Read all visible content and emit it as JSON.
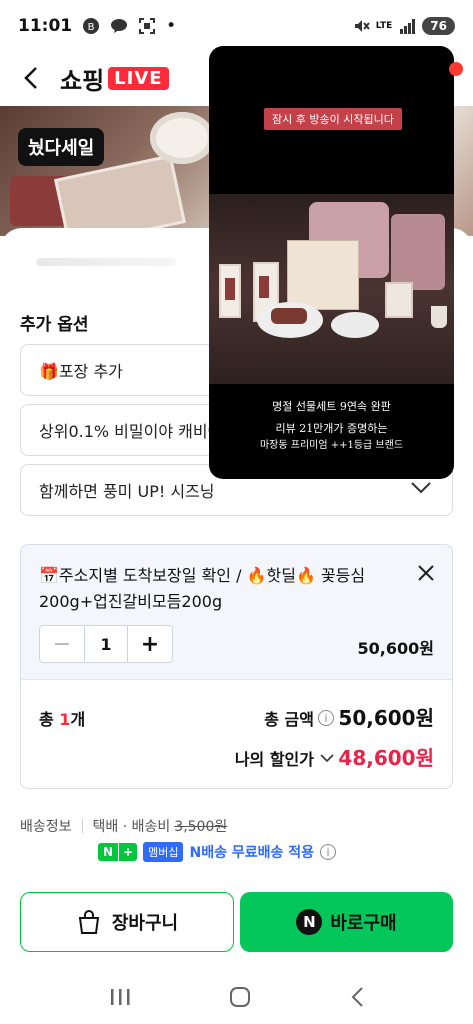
{
  "status_bar": {
    "time": "11:01",
    "dot": "•",
    "network": "LTE",
    "battery": "76"
  },
  "header": {
    "brand_text": "쇼핑",
    "brand_live": "LIVE"
  },
  "banner": {
    "badge": "눴다세일"
  },
  "live_video": {
    "banner_text": "잠시 후 방송이 시작됩니다",
    "caption_line1": "명절 선물세트 9연속 완판",
    "caption_line2": "리뷰 21만개가 증명하는",
    "caption_line3": "마장동 프리미엄 ++1등급 브랜드"
  },
  "options": {
    "section_label": "추가 옵션",
    "items": [
      {
        "label": "🎁포장 추가"
      },
      {
        "label": "상위0.1% 비밀이야 캐비어"
      },
      {
        "label": "함께하면 풍미 UP! 시즈닝"
      }
    ]
  },
  "selected_item": {
    "title": "📅주소지별 도착보장일 확인 / 🔥핫딜🔥 꽃등심200g+업진갈비모듬200g",
    "quantity": "1",
    "price": "50,600원",
    "minus": "−",
    "plus": "+"
  },
  "total": {
    "count_prefix": "총 ",
    "count_num": "1",
    "count_suffix": "개",
    "amount_label": "총 금액",
    "amount": "50,600원",
    "discount_label": "나의 할인가",
    "discount_amount": "48,600원"
  },
  "shipping": {
    "label": "배송정보",
    "method": "택배 · 배송비",
    "fee": "3,500원",
    "npay_n": "N",
    "npay_plus": "+",
    "membership": "멤버십",
    "free_text": "N배송 무료배송 적용"
  },
  "actions": {
    "cart_label": "장바구니",
    "buy_label": "바로구매",
    "buy_n": "N"
  },
  "colors": {
    "accent_red": "#ff2b3a",
    "naver_green": "#03c75a",
    "discount_red": "#e8234a",
    "member_blue": "#2f6bff"
  }
}
